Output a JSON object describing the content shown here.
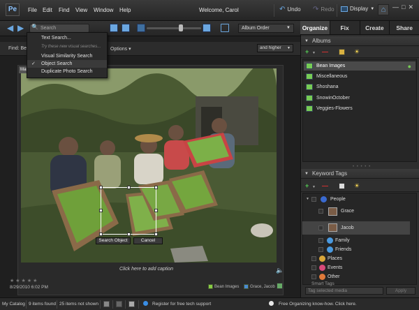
{
  "menubar": {
    "logo": "Pe",
    "menus": [
      "File",
      "Edit",
      "Find",
      "View",
      "Window",
      "Help"
    ],
    "welcome": "Welcome, Carol",
    "undo": "Undo",
    "redo": "Redo",
    "display": "Display"
  },
  "toolbar": {
    "search_placeholder": "Search",
    "sort_order": "Album Order"
  },
  "findbar": {
    "label": "Find: Bea",
    "options": "Options",
    "rating_filter": "and higher"
  },
  "search_menu": {
    "items": [
      "Text Search...",
      "Visual Similarity Search",
      "Object Search",
      "Duplicate Photo Search"
    ],
    "note": "Try these new visual searches...",
    "checked_item": "Object Search"
  },
  "media": {
    "mark_tag": "Mark",
    "caption": "Click here to add caption",
    "date": "8/29/2010 6:02 PM",
    "tags": [
      "Bean Images",
      "Grace, Jacob"
    ],
    "search_object_btn": "Search Object",
    "cancel_btn": "Cancel"
  },
  "panel": {
    "tabs": [
      "Organize",
      "Fix",
      "Create",
      "Share"
    ],
    "active_tab": "Organize",
    "albums_title": "Albums",
    "albums": [
      "Bean Images",
      "Miscellaneous",
      "Shoshana",
      "SnowinOctober",
      "Veggies-Flowers"
    ],
    "selected_album": "Bean Images",
    "keyword_title": "Keyword Tags",
    "keyword_tags": {
      "people": "People",
      "grace": "Grace",
      "jacob": "Jacob",
      "family": "Family",
      "friends": "Friends",
      "places": "Places",
      "events": "Events",
      "other": "Other",
      "smart_tags": "Smart Tags"
    },
    "tag_search_placeholder": "Tag selected media",
    "apply": "Apply"
  },
  "status": {
    "catalog": "My Catalog",
    "found": "9 items found",
    "not_shown": "25 items not shown",
    "register": "Register for free tech support",
    "organizing": "Free Organizing know-how. Click here."
  },
  "colors": {
    "accent": "#3a8ee6",
    "album_icon": "#77cc55"
  }
}
